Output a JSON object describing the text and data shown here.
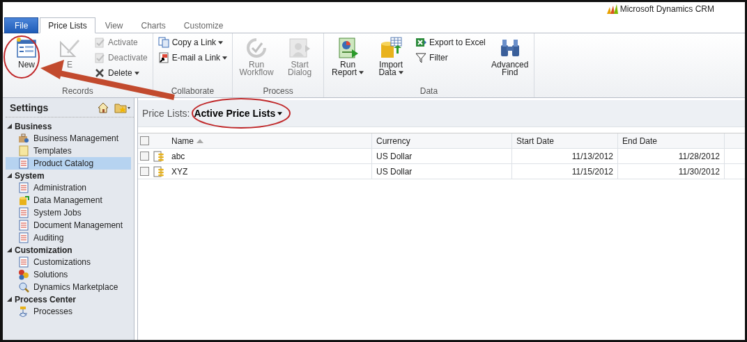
{
  "brand": "Microsoft Dynamics CRM",
  "tabs": [
    {
      "label": "File",
      "kind": "file",
      "selected": false
    },
    {
      "label": "Price Lists",
      "kind": "tab",
      "selected": true
    },
    {
      "label": "View",
      "kind": "tab",
      "selected": false
    },
    {
      "label": "Charts",
      "kind": "tab",
      "selected": false
    },
    {
      "label": "Customize",
      "kind": "tab",
      "selected": false
    }
  ],
  "ribbon_groups": [
    {
      "title": "Records",
      "commands": [
        {
          "label": "New",
          "kind": "large",
          "disabled": false,
          "dropdown": false
        },
        {
          "label": "E",
          "kind": "large",
          "disabled": true,
          "dropdown": false
        },
        {
          "label": "Activate",
          "kind": "small",
          "disabled": true,
          "dropdown": false
        },
        {
          "label": "Deactivate",
          "kind": "small",
          "disabled": true,
          "dropdown": false
        },
        {
          "label": "Delete",
          "kind": "small",
          "disabled": false,
          "dropdown": true
        }
      ]
    },
    {
      "title": "Collaborate",
      "commands": [
        {
          "label": "Copy a Link",
          "kind": "small",
          "disabled": false,
          "dropdown": true
        },
        {
          "label": "E-mail a Link",
          "kind": "small",
          "disabled": false,
          "dropdown": true
        }
      ]
    },
    {
      "title": "Process",
      "commands": [
        {
          "label": "Run Workflow",
          "kind": "large",
          "disabled": true,
          "dropdown": false
        },
        {
          "label": "Start Dialog",
          "kind": "large",
          "disabled": true,
          "dropdown": false
        }
      ]
    },
    {
      "title": "Data",
      "commands": [
        {
          "label": "Run Report",
          "kind": "large",
          "disabled": false,
          "dropdown": true
        },
        {
          "label": "Import Data",
          "kind": "large",
          "disabled": false,
          "dropdown": true
        },
        {
          "label": "Export to Excel",
          "kind": "small",
          "disabled": false,
          "dropdown": false
        },
        {
          "label": "Filter",
          "kind": "small",
          "disabled": false,
          "dropdown": false
        },
        {
          "label": "Advanced Find",
          "kind": "large",
          "disabled": false,
          "dropdown": false
        }
      ]
    }
  ],
  "sidebar": {
    "title": "Settings",
    "sections": [
      {
        "title": "Business",
        "expanded": true,
        "items": [
          {
            "label": "Business Management",
            "selected": false
          },
          {
            "label": "Templates",
            "selected": false
          },
          {
            "label": "Product Catalog",
            "selected": true
          }
        ]
      },
      {
        "title": "System",
        "expanded": true,
        "items": [
          {
            "label": "Administration",
            "selected": false
          },
          {
            "label": "Data Management",
            "selected": false
          },
          {
            "label": "System Jobs",
            "selected": false
          },
          {
            "label": "Document Management",
            "selected": false
          },
          {
            "label": "Auditing",
            "selected": false
          }
        ]
      },
      {
        "title": "Customization",
        "expanded": true,
        "items": [
          {
            "label": "Customizations",
            "selected": false
          },
          {
            "label": "Solutions",
            "selected": false
          },
          {
            "label": "Dynamics Marketplace",
            "selected": false
          }
        ]
      },
      {
        "title": "Process Center",
        "expanded": true,
        "items": [
          {
            "label": "Processes",
            "selected": false
          }
        ]
      }
    ]
  },
  "view": {
    "label": "Price Lists:",
    "name": "Active Price Lists"
  },
  "table": {
    "select_all_checked": false,
    "columns": [
      {
        "label": "Name",
        "sorted": true
      },
      {
        "label": "Currency",
        "sorted": false
      },
      {
        "label": "Start Date",
        "sorted": false
      },
      {
        "label": "End Date",
        "sorted": false
      }
    ],
    "rows": [
      {
        "checked": false,
        "cells": [
          "abc",
          "US Dollar",
          "11/13/2012",
          "11/28/2012"
        ]
      },
      {
        "checked": false,
        "cells": [
          "XYZ",
          "US Dollar",
          "11/15/2012",
          "11/30/2012"
        ]
      }
    ]
  }
}
